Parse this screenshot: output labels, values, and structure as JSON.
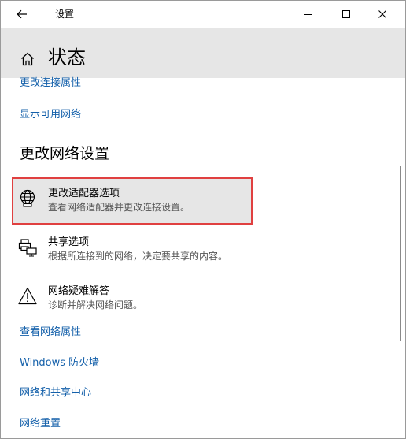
{
  "window": {
    "title": "设置",
    "back_icon": "arrow-left-icon",
    "minimize_icon": "minimize-icon",
    "maximize_icon": "maximize-icon",
    "close_icon": "close-icon"
  },
  "header": {
    "home_icon": "home-icon",
    "page_title": "状态"
  },
  "links_top": [
    {
      "label": "更改连接属性"
    },
    {
      "label": "显示可用网络"
    }
  ],
  "section": {
    "heading": "更改网络设置"
  },
  "options": [
    {
      "icon": "network-adapter-globe-icon",
      "title": "更改适配器选项",
      "description": "查看网络适配器并更改连接设置。",
      "highlighted": true
    },
    {
      "icon": "sharing-printer-icon",
      "title": "共享选项",
      "description": "根据所连接到的网络，决定要共享的内容。",
      "highlighted": false
    },
    {
      "icon": "warning-triangle-icon",
      "title": "网络疑难解答",
      "description": "诊断并解决网络问题。",
      "highlighted": false
    }
  ],
  "links_bottom": [
    {
      "label": "查看网络属性"
    },
    {
      "label": "Windows 防火墙"
    },
    {
      "label": "网络和共享中心"
    },
    {
      "label": "网络重置"
    }
  ],
  "colors": {
    "link": "#1460aa",
    "highlight_border": "#e04040",
    "header_bg": "#e6e6e6"
  }
}
